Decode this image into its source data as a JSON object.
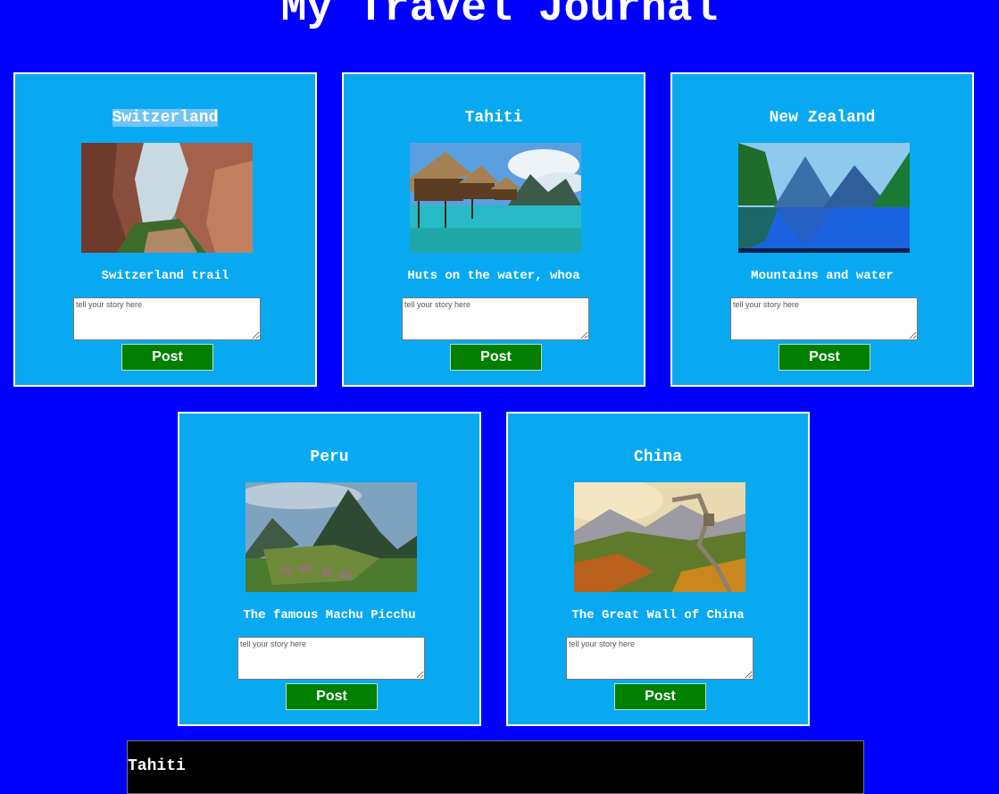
{
  "page": {
    "title": "My Travel Journal"
  },
  "cards": [
    {
      "title": "Switzerland",
      "caption": "Switzerland trail",
      "placeholder": "tell your story here",
      "button": "Post"
    },
    {
      "title": "Tahiti",
      "caption": "Huts on the water, whoa",
      "placeholder": "tell your story here",
      "button": "Post"
    },
    {
      "title": "New Zealand",
      "caption": "Mountains and water",
      "placeholder": "tell your story here",
      "button": "Post"
    },
    {
      "title": "Peru",
      "caption": "The famous Machu Picchu",
      "placeholder": "tell your story here",
      "button": "Post"
    },
    {
      "title": "China",
      "caption": "The Great Wall of China",
      "placeholder": "tell your story here",
      "button": "Post"
    }
  ],
  "result": {
    "title": "Tahiti"
  },
  "colors": {
    "background": "#0000ff",
    "card": "#09a9f2",
    "button": "#007f00",
    "panel": "#000000"
  }
}
